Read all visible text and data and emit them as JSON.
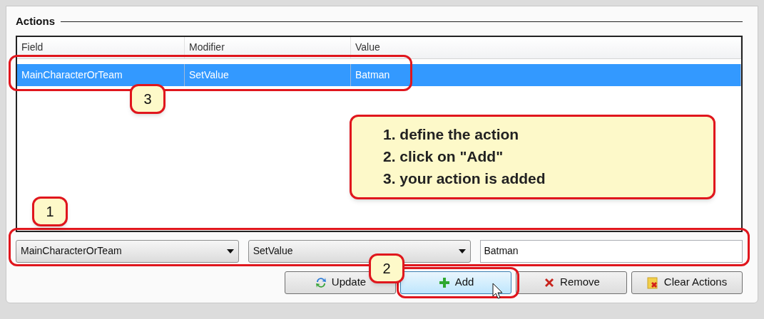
{
  "group": {
    "title": "Actions"
  },
  "table": {
    "columns": [
      "Field",
      "Modifier",
      "Value"
    ],
    "rows": [
      {
        "cells": [
          "MainCharacterOrTeam",
          "SetValue",
          "Batman"
        ],
        "selected": true
      }
    ]
  },
  "editor": {
    "field_select": {
      "value": "MainCharacterOrTeam"
    },
    "modifier_select": {
      "value": "SetValue"
    },
    "value_input": {
      "value": "Batman"
    }
  },
  "buttons": [
    {
      "label": "Update",
      "kind": "update",
      "hovered": false
    },
    {
      "label": "Add",
      "kind": "add",
      "hovered": true
    },
    {
      "label": "Remove",
      "kind": "remove",
      "hovered": false
    },
    {
      "label": "Clear Actions",
      "kind": "clear",
      "hovered": false
    }
  ],
  "annotations": {
    "callouts": [
      {
        "label": "3"
      },
      {
        "label": "1"
      },
      {
        "label": "2"
      }
    ],
    "note": {
      "lines": [
        "1. define the action",
        "2. click on \"Add\"",
        "3. your action is added"
      ]
    }
  }
}
